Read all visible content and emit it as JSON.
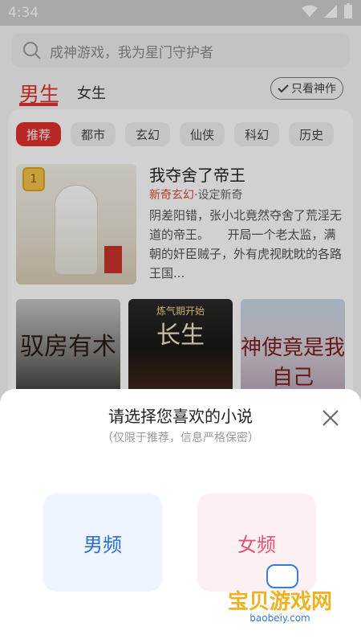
{
  "status": {
    "time": "4:34"
  },
  "search": {
    "placeholder": "成神游戏，我为星门守护者"
  },
  "gender_tabs": {
    "male": "男生",
    "female": "女生",
    "only_btn": "只看神作"
  },
  "categories": [
    "推荐",
    "都市",
    "玄幻",
    "仙侠",
    "科幻",
    "历史"
  ],
  "featured_book": {
    "rank": "1",
    "title": "我夺舍了帝王",
    "genre": "新奇玄幻",
    "setting": "·设定新奇",
    "description": "阴差阳错，张小北竟然夺舍了荒淫无道的帝王。　　开局一个老太监，满朝的奸臣贼子，外有虎视眈眈的各路王国..."
  },
  "small_books": [
    {
      "title_art": "驭房有术"
    },
    {
      "top_text": "炼气期开始",
      "title_art": "长生"
    },
    {
      "title_art": "神使竟是我自己"
    }
  ],
  "sheet": {
    "title": "请选择您喜欢的小说",
    "subtitle": "（仅限于推荐，信息严格保密）",
    "male_option": "男频",
    "female_option": "女频"
  },
  "watermark": {
    "name": "宝贝游戏网",
    "url": "baobeiy.com"
  },
  "colors": {
    "accent": "#e0312f",
    "male": "#2a6fd0",
    "female": "#e35272"
  }
}
